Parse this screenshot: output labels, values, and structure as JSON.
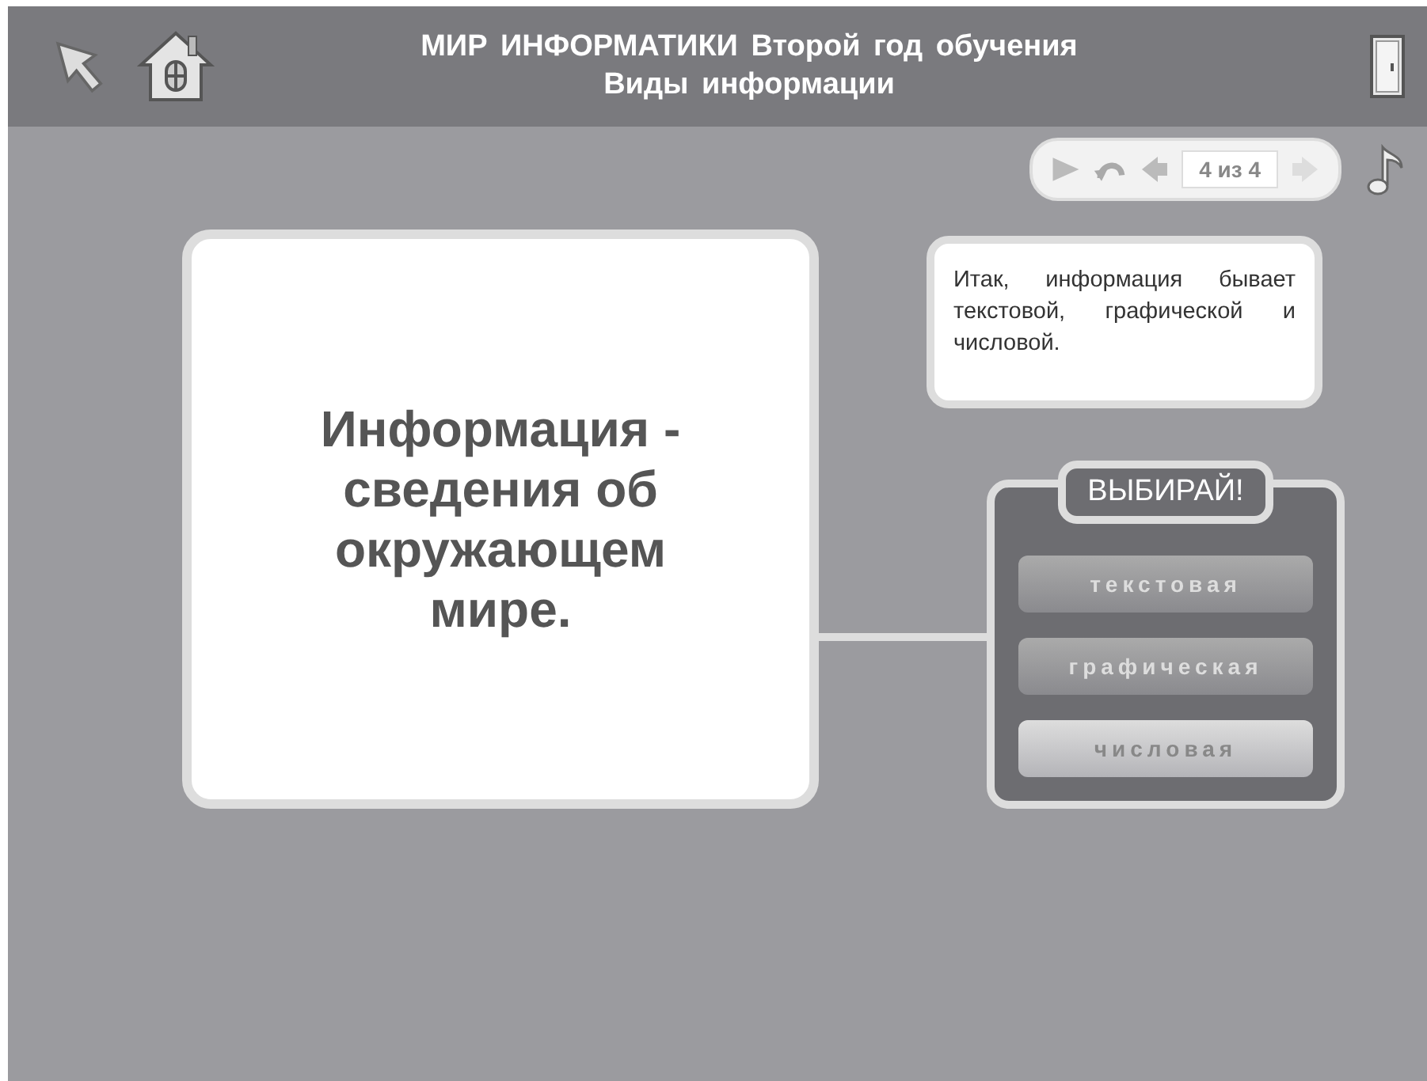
{
  "header": {
    "title": "МИР ИНФОРМАТИКИ Второй год обучения",
    "subtitle": "Виды информации"
  },
  "nav": {
    "page": "4 из 4"
  },
  "definition": "Информация - сведения об окружающем мире.",
  "summary": "Итак, информация бывает текстовой, графической и числовой.",
  "choice": {
    "title": "ВЫБИРАЙ!",
    "options": [
      {
        "label": "текстовая",
        "selected": false
      },
      {
        "label": "графическая",
        "selected": false
      },
      {
        "label": "числовая",
        "selected": true
      }
    ]
  }
}
